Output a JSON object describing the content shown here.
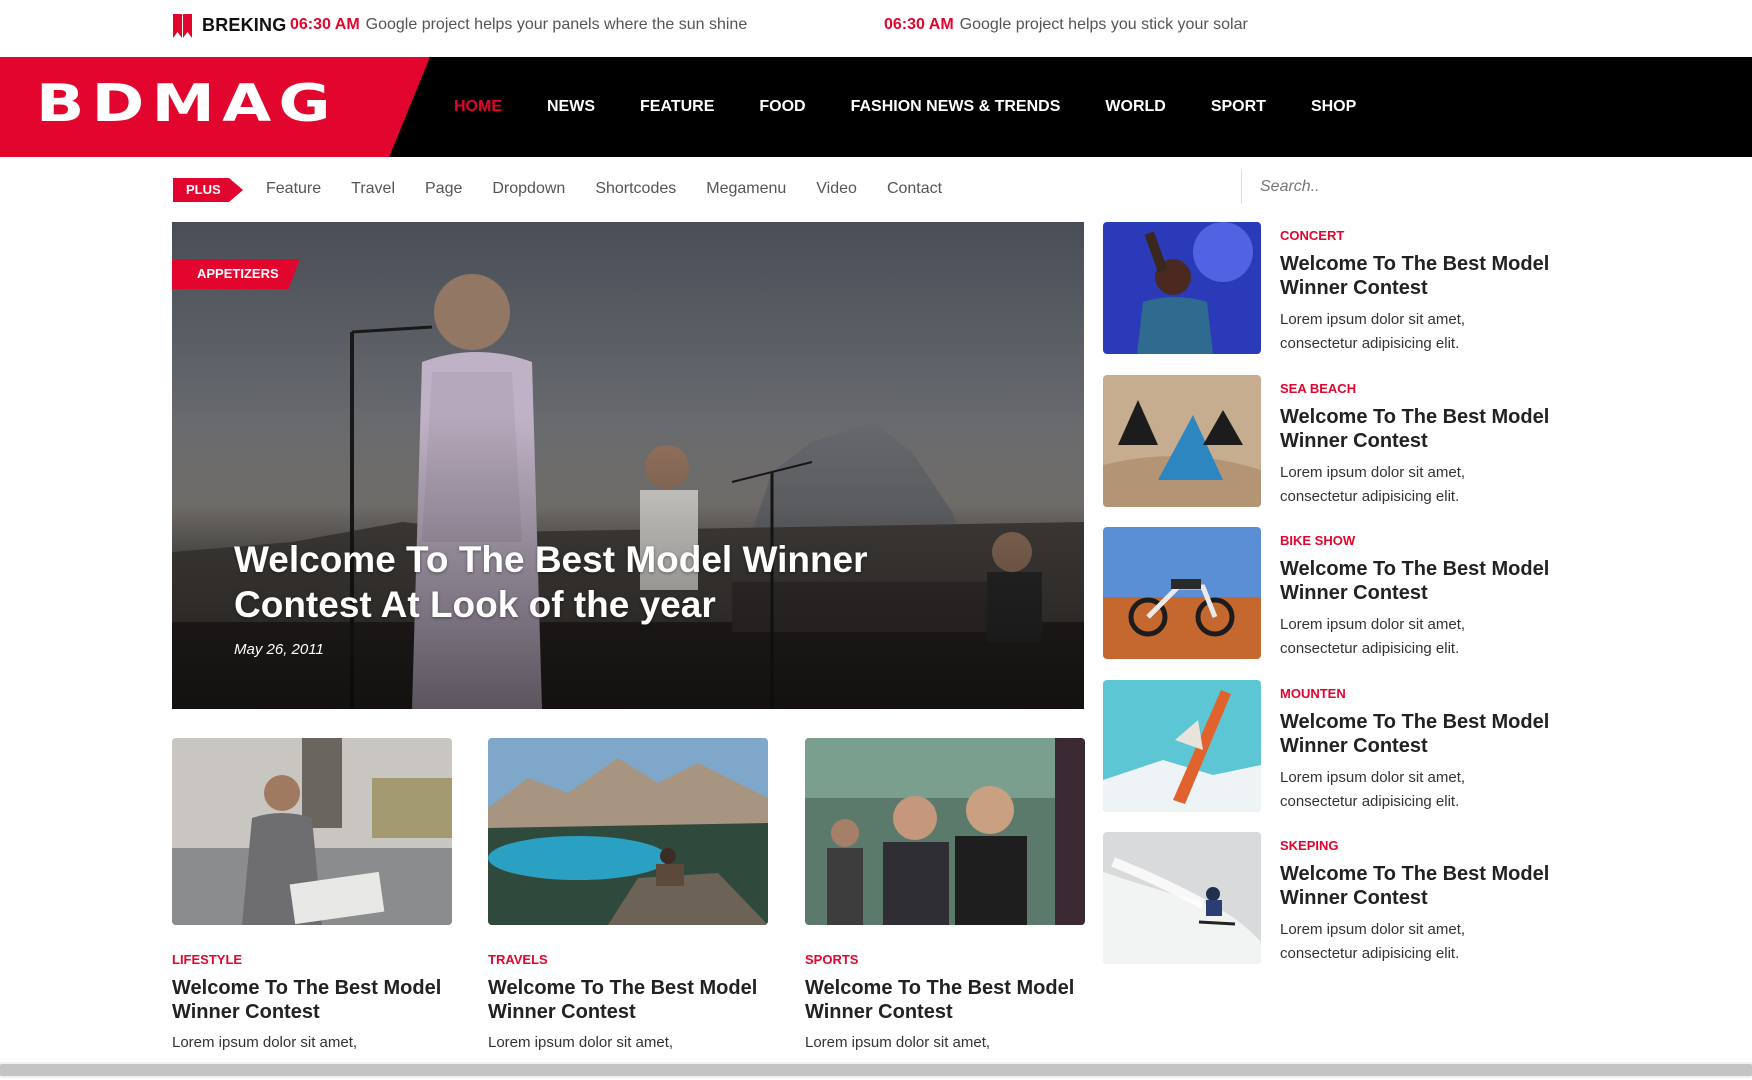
{
  "breaking": {
    "label": "BREKING",
    "items": [
      {
        "time": "06:30 AM",
        "text": "Google project helps your panels where the sun shine"
      },
      {
        "time": "06:30 AM",
        "text": "Google project helps you stick your solar"
      }
    ]
  },
  "header": {
    "logo": "BDMAG",
    "nav": [
      {
        "label": "HOME",
        "active": true
      },
      {
        "label": "NEWS"
      },
      {
        "label": "FEATURE"
      },
      {
        "label": "FOOD"
      },
      {
        "label": "FASHION NEWS & TRENDS"
      },
      {
        "label": "WORLD"
      },
      {
        "label": "SPORT"
      },
      {
        "label": "SHOP"
      }
    ]
  },
  "subnav": {
    "tag": "PLUS",
    "links": [
      "Feature",
      "Travel",
      "Page",
      "Dropdown",
      "Shortcodes",
      "Megamenu",
      "Video",
      "Contact"
    ],
    "search_placeholder": "Search.."
  },
  "hero": {
    "category": "APPETIZERS",
    "title": "Welcome To The Best Model Winner Contest At Look of the year",
    "date": "May 26, 2011"
  },
  "cards": [
    {
      "category": "LIFESTYLE",
      "title": "Welcome To The Best Model Winner Contest",
      "excerpt": "Lorem ipsum dolor sit amet,"
    },
    {
      "category": "TRAVELS",
      "title": "Welcome To The Best Model Winner Contest",
      "excerpt": "Lorem ipsum dolor sit amet,"
    },
    {
      "category": "SPORTS",
      "title": "Welcome To The Best Model Winner Contest",
      "excerpt": "Lorem ipsum dolor sit amet,"
    }
  ],
  "sidebar": [
    {
      "category": "CONCERT",
      "title": "Welcome To The Best Model Winner Contest",
      "excerpt": "Lorem ipsum dolor sit amet, consectetur adipisicing elit."
    },
    {
      "category": "SEA BEACH",
      "title": "Welcome To The Best Model Winner Contest",
      "excerpt": "Lorem ipsum dolor sit amet, consectetur adipisicing elit."
    },
    {
      "category": "BIKE SHOW",
      "title": "Welcome To The Best Model Winner Contest",
      "excerpt": "Lorem ipsum dolor sit amet, consectetur adipisicing elit."
    },
    {
      "category": "MOUNTEN",
      "title": "Welcome To The Best Model Winner Contest",
      "excerpt": "Lorem ipsum dolor sit amet, consectetur adipisicing elit."
    },
    {
      "category": "SKEPING",
      "title": "Welcome To The Best Model Winner Contest",
      "excerpt": "Lorem ipsum dolor sit amet, consectetur adipisicing elit."
    }
  ],
  "colors": {
    "accent": "#e2062e",
    "header_bg": "#000000",
    "text": "#222222"
  },
  "icons": {
    "breaking": "bookmark-icon"
  }
}
